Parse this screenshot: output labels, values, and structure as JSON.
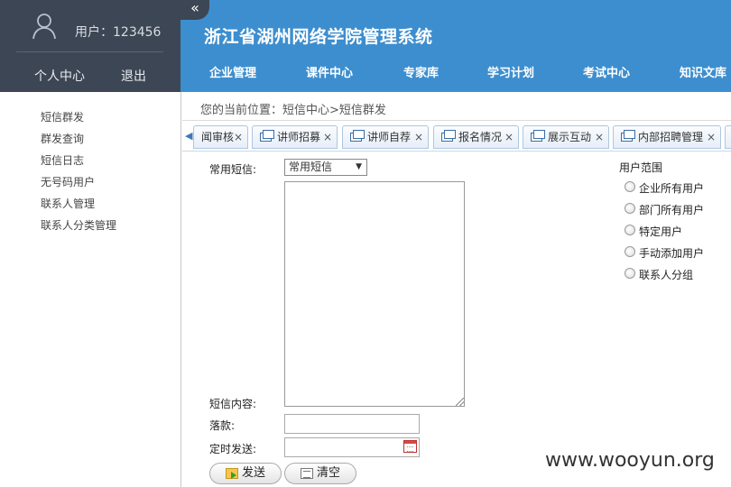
{
  "user": {
    "username": "用户：123456",
    "links": [
      "个人中心",
      "退出"
    ]
  },
  "collapse_icon": "«",
  "header": {
    "title": "浙江省湖州网络学院管理系统",
    "nav": [
      "企业管理",
      "课件中心",
      "专家库",
      "学习计划",
      "考试中心",
      "知识文库"
    ]
  },
  "sidebar": {
    "items": [
      "短信群发",
      "群发查询",
      "短信日志",
      "无号码用户",
      "联系人管理",
      "联系人分类管理"
    ]
  },
  "breadcrumb": "您的当前位置：短信中心>短信群发",
  "tabs": {
    "partial_label": "闻审核",
    "items": [
      "讲师招募",
      "讲师自荐",
      "报名情况",
      "展示互动",
      "内部招聘管理"
    ],
    "close": "×"
  },
  "form": {
    "common_sms_label": "常用短信:",
    "common_sms_value": "常用短信",
    "content_label": "短信内容:",
    "signature_label": "落款:",
    "scheduled_label": "定时发送:",
    "send_button": "发送",
    "clear_button": "清空"
  },
  "user_range": {
    "title": "用户范围",
    "options": [
      "企业所有用户",
      "部门所有用户",
      "特定用户",
      "手动添加用户",
      "联系人分组"
    ]
  },
  "watermark": "www.wooyun.org",
  "colors": {
    "header_blue": "#3d8ecf",
    "panel_dark": "#3d4654"
  }
}
